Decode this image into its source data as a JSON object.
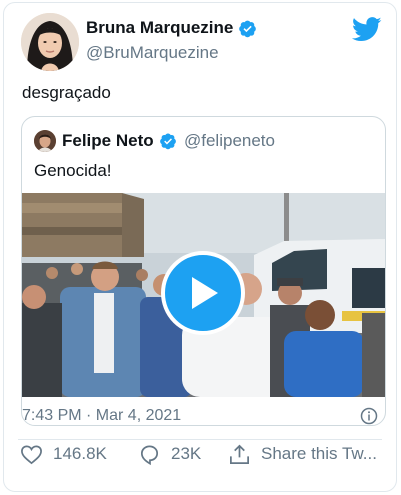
{
  "tweet": {
    "author_name": "Bruna Marquezine",
    "author_handle": "@BruMarquezine",
    "text": "desgraçado",
    "timestamp": "7:43 PM · Mar 4, 2021"
  },
  "quoted": {
    "author_name": "Felipe Neto",
    "author_handle": "@felipeneto",
    "text": "Genocida!"
  },
  "actions": {
    "likes": "146.8K",
    "replies": "23K",
    "share_label": "Share this Tw..."
  },
  "colors": {
    "brand": "#1da1f2",
    "secondary_text": "#657786",
    "border": "#e1e8ed"
  },
  "icons": {
    "brand": "twitter-bird-icon",
    "verified": "verified-badge-icon",
    "like": "heart-icon",
    "reply": "reply-bubble-icon",
    "share": "share-icon",
    "info": "info-icon",
    "play": "play-icon"
  }
}
